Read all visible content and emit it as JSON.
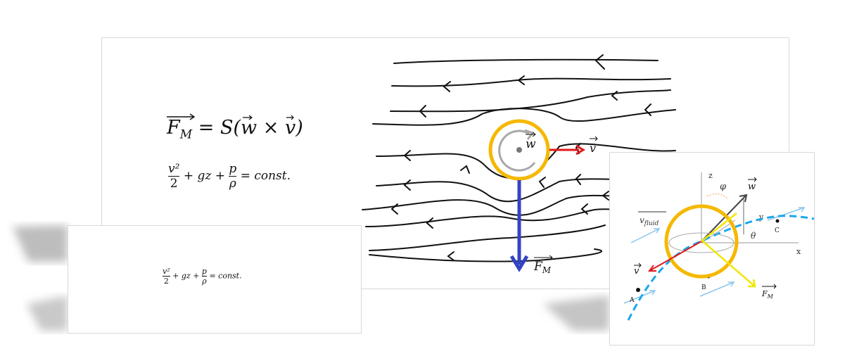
{
  "main_slide": {
    "formula_force": "F_M = S(w × v)",
    "formula_bernoulli": "v²/2 + gz + p/ρ = const.",
    "label_w": "w",
    "label_v": "v",
    "label_F": "F",
    "label_F_sub": "M"
  },
  "small_slide": {
    "formula_bernoulli": "v²/2 + gz + p/ρ = const."
  },
  "diagram_3d": {
    "axis_z": "z",
    "axis_y": "y",
    "axis_x": "x",
    "angle_phi": "φ",
    "angle_theta": "θ",
    "label_w": "w",
    "label_v_fluid": "v",
    "label_v_fluid_sub": "fluid",
    "label_v": "v",
    "label_F": "F",
    "label_F_sub": "M",
    "point_a": "A",
    "point_b": "B",
    "point_c": "C"
  },
  "colors": {
    "streamline": "#111111",
    "ring": "#f5b800",
    "vector_v": "#e0191b",
    "vector_F": "#3442c4",
    "trajectory": "#1aa6ee",
    "flow_arrow": "#8ac6ee",
    "yellow_arrow": "#f2e600",
    "rotation_arrow": "#a8a8a8"
  }
}
